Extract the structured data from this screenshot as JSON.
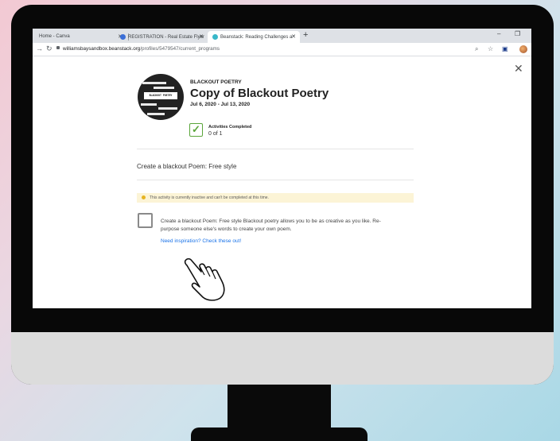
{
  "browser": {
    "tabs": [
      {
        "label": "Home - Canva",
        "active": false,
        "favicon_color": ""
      },
      {
        "label": "REGISTRATION - Real Estate Flyer",
        "active": false,
        "favicon_color": "#3b6fd8"
      },
      {
        "label": "Beanstack: Reading Challenges a",
        "active": true,
        "favicon_color": "#39b8c9"
      }
    ],
    "new_tab_symbol": "+",
    "window_controls": {
      "minimize": "–",
      "restore": "❐"
    },
    "url": {
      "host": "williamsbaysandbox.beanstack.org",
      "path": "/profiles/5479547/current_programs"
    },
    "toolbar_icons": [
      "search-icon",
      "star-icon",
      "extension-icon"
    ]
  },
  "program": {
    "category": "BLACKOUT POETRY",
    "title": "Copy of Blackout Poetry",
    "dates": "Jul 6, 2020 - Jul 13, 2020",
    "badge_text": "BLACKOUT POETRY",
    "activities_label": "Activities Completed",
    "activities_count": "0 of 1",
    "close_symbol": "✕"
  },
  "activity": {
    "title": "Create a blackout Poem: Free style",
    "notice": "This activity is currently inactive and can't be completed at this time.",
    "description": "Create a blackout Poem: Free style Blackout poetry allows you to be as creative as you like. Re-purpose someone else's words to create your own poem.",
    "link_text": "Need inspiration? Check these out!",
    "completed": false
  },
  "colors": {
    "accent_green": "#5aa53a",
    "link_blue": "#1a73e8",
    "notice_bg": "#fcf4d6"
  }
}
